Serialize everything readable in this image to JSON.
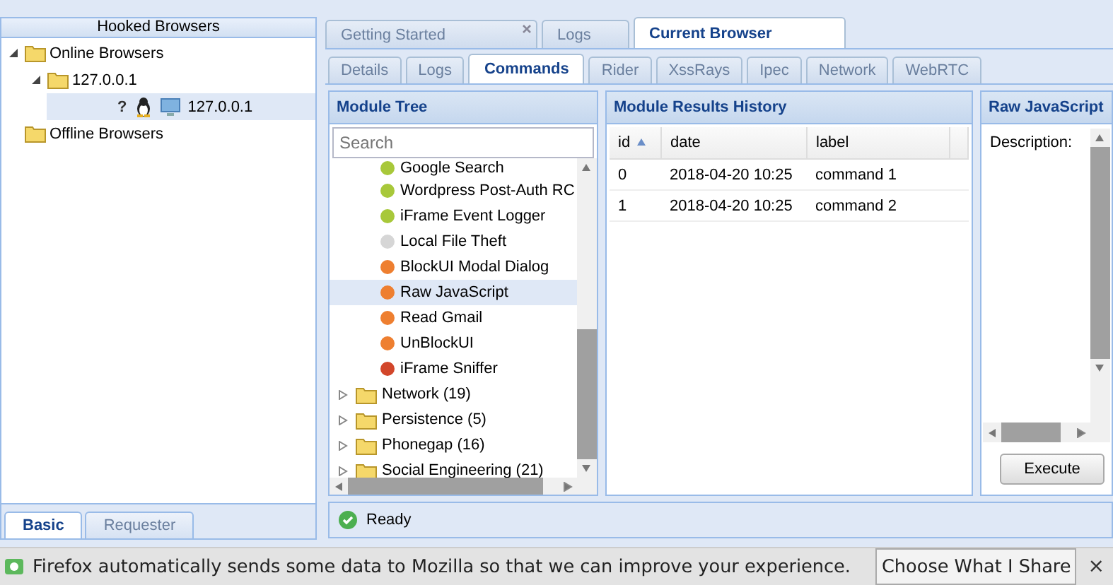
{
  "left_panel": {
    "title": "Hooked Browsers",
    "tree": [
      {
        "label": "Online Browsers",
        "expanded": true,
        "children": [
          {
            "label": "127.0.0.1",
            "expanded": true,
            "children": [
              {
                "label": "127.0.0.1",
                "selected": true,
                "kind": "browser",
                "badge": "?"
              }
            ]
          }
        ]
      },
      {
        "label": "Offline Browsers",
        "expanded": false
      }
    ],
    "tabs": [
      {
        "label": "Basic",
        "selected": true
      },
      {
        "label": "Requester",
        "selected": false
      }
    ]
  },
  "main_tabs": [
    {
      "label": "Getting Started",
      "selected": false,
      "closable": true
    },
    {
      "label": "Logs",
      "selected": false,
      "closable": false
    },
    {
      "label": "Current Browser",
      "selected": true,
      "closable": false
    }
  ],
  "sub_tabs": [
    {
      "label": "Details",
      "selected": false
    },
    {
      "label": "Logs",
      "selected": false
    },
    {
      "label": "Commands",
      "selected": true
    },
    {
      "label": "Rider",
      "selected": false
    },
    {
      "label": "XssRays",
      "selected": false
    },
    {
      "label": "Ipec",
      "selected": false
    },
    {
      "label": "Network",
      "selected": false
    },
    {
      "label": "WebRTC",
      "selected": false
    }
  ],
  "module_tree": {
    "title": "Module Tree",
    "search": {
      "placeholder": "Search"
    },
    "modules": [
      {
        "label": "Google Search",
        "color": "#a8c83a",
        "selected": false
      },
      {
        "label": "Wordpress Post-Auth RC",
        "color": "#a8c83a",
        "selected": false
      },
      {
        "label": "iFrame Event Logger",
        "color": "#a8c83a",
        "selected": false
      },
      {
        "label": "Local File Theft",
        "color": "#d6d6d6",
        "selected": false
      },
      {
        "label": "BlockUI Modal Dialog",
        "color": "#ee7f30",
        "selected": false
      },
      {
        "label": "Raw JavaScript",
        "color": "#ee7f30",
        "selected": true
      },
      {
        "label": "Read Gmail",
        "color": "#ee7f30",
        "selected": false
      },
      {
        "label": "UnBlockUI",
        "color": "#ee7f30",
        "selected": false
      },
      {
        "label": "iFrame Sniffer",
        "color": "#d2462a",
        "selected": false
      }
    ],
    "categories": [
      {
        "label": "Network (19)"
      },
      {
        "label": "Persistence (5)"
      },
      {
        "label": "Phonegap (16)"
      },
      {
        "label": "Social Engineering (21)"
      }
    ]
  },
  "results": {
    "title": "Module Results History",
    "columns": [
      "id",
      "date",
      "label"
    ],
    "rows": [
      [
        "0",
        "2018-04-20 10:25",
        "command 1"
      ],
      [
        "1",
        "2018-04-20 10:25",
        "command 2"
      ]
    ]
  },
  "raw_js": {
    "title": "Raw JavaScript",
    "description_label": "Description:",
    "execute_button": "Execute"
  },
  "status_bar": {
    "text": "Ready"
  },
  "notification": {
    "text": "Firefox automatically sends some data to Mozilla so that we can improve your experience.",
    "button": "Choose What I Share",
    "close": "×"
  }
}
